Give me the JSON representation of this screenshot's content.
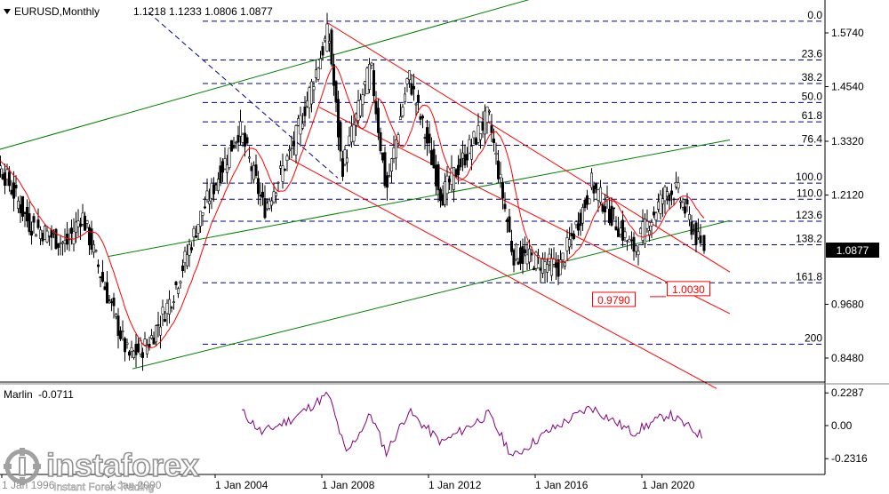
{
  "header": {
    "symbol": "EURUSD,Monthly",
    "ohlc": "1.1218 1.1233 1.0806 1.0877"
  },
  "indicator": {
    "name": "Marlin",
    "value": "-0.0711",
    "ticks": [
      "0.2287",
      "0.00",
      "-0.2316"
    ],
    "tick_values": [
      0.2287,
      0.0,
      -0.2316
    ]
  },
  "watermark": {
    "brand": "instaforex",
    "tagline": "Instant Forex Trading"
  },
  "price_ticks": [
    "1.5740",
    "1.4540",
    "1.3320",
    "1.2120",
    "0.9680",
    "0.8480"
  ],
  "price_tick_values": [
    1.574,
    1.454,
    1.332,
    1.212,
    0.968,
    0.848
  ],
  "current_price": "1.0877",
  "date_ticks": [
    "1 Jan 2004",
    "1 Jan 2008",
    "1 Jan 2012",
    "1 Jan 2016",
    "1 Jan 2020"
  ],
  "partial_date_ticks": [
    "1 Jan 1996",
    "1 Jan 2000"
  ],
  "fib_levels": [
    {
      "label": "0.0",
      "price": 1.6
    },
    {
      "label": "23.6",
      "price": 1.5135
    },
    {
      "label": "38.2",
      "price": 1.461
    },
    {
      "label": "50.0",
      "price": 1.4185
    },
    {
      "label": "61.8",
      "price": 1.3755
    },
    {
      "label": "76.4",
      "price": 1.323
    },
    {
      "label": "100.0",
      "price": 1.2385
    },
    {
      "label": "110.0",
      "price": 1.2025
    },
    {
      "label": "123.6",
      "price": 1.1535
    },
    {
      "label": "138.2",
      "price": 1.101
    },
    {
      "label": "161.8",
      "price": 1.016
    },
    {
      "label": "200",
      "price": 0.879
    }
  ],
  "price_labels": [
    {
      "text": "1.0030",
      "price": 1.003
    },
    {
      "text": "0.9790",
      "price": 0.979
    }
  ],
  "colors": {
    "candles": "#000000",
    "moving_average": "#ff0000",
    "channel_red": "#ff0000",
    "channel_green": "#008000",
    "fib_lines": "#00008b",
    "oscillator": "#800080",
    "axis_text": "#000000"
  },
  "chart_data": {
    "type": "candlestick",
    "title": "EURUSD,Monthly",
    "timeframe": "Monthly",
    "last_bar": {
      "open": 1.1218,
      "high": 1.1233,
      "low": 1.0806,
      "close": 1.0877
    },
    "ylim": [
      0.79,
      1.62
    ],
    "xlim": [
      "1994-11",
      "2022-12"
    ],
    "closes_approx": [
      {
        "date": "1995-01",
        "close": 1.31
      },
      {
        "date": "1996-01",
        "close": 1.27
      },
      {
        "date": "1997-01",
        "close": 1.15
      },
      {
        "date": "1998-06",
        "close": 1.1
      },
      {
        "date": "1999-01",
        "close": 1.17
      },
      {
        "date": "2000-01",
        "close": 0.98
      },
      {
        "date": "2000-10",
        "close": 0.85
      },
      {
        "date": "2001-07",
        "close": 0.88
      },
      {
        "date": "2002-06",
        "close": 0.99
      },
      {
        "date": "2003-06",
        "close": 1.16
      },
      {
        "date": "2004-12",
        "close": 1.36
      },
      {
        "date": "2005-11",
        "close": 1.18
      },
      {
        "date": "2006-12",
        "close": 1.32
      },
      {
        "date": "2008-04",
        "close": 1.58
      },
      {
        "date": "2008-10",
        "close": 1.27
      },
      {
        "date": "2009-11",
        "close": 1.5
      },
      {
        "date": "2010-06",
        "close": 1.22
      },
      {
        "date": "2011-04",
        "close": 1.48
      },
      {
        "date": "2012-07",
        "close": 1.21
      },
      {
        "date": "2014-04",
        "close": 1.39
      },
      {
        "date": "2015-03",
        "close": 1.08
      },
      {
        "date": "2016-12",
        "close": 1.05
      },
      {
        "date": "2017-12",
        "close": 1.2
      },
      {
        "date": "2018-02",
        "close": 1.24
      },
      {
        "date": "2019-09",
        "close": 1.09
      },
      {
        "date": "2020-12",
        "close": 1.22
      },
      {
        "date": "2021-05",
        "close": 1.22
      },
      {
        "date": "2022-04",
        "close": 1.0877
      }
    ],
    "oscillator": {
      "name": "Marlin",
      "values_approx": [
        {
          "date": "2005-01",
          "value": 0.1
        },
        {
          "date": "2005-10",
          "value": -0.05
        },
        {
          "date": "2006-12",
          "value": 0.05
        },
        {
          "date": "2008-04",
          "value": 0.22
        },
        {
          "date": "2008-12",
          "value": -0.2
        },
        {
          "date": "2009-11",
          "value": 0.08
        },
        {
          "date": "2010-06",
          "value": -0.19
        },
        {
          "date": "2011-04",
          "value": 0.1
        },
        {
          "date": "2012-07",
          "value": -0.12
        },
        {
          "date": "2014-04",
          "value": 0.08
        },
        {
          "date": "2015-03",
          "value": -0.22
        },
        {
          "date": "2016-06",
          "value": -0.05
        },
        {
          "date": "2018-02",
          "value": 0.13
        },
        {
          "date": "2019-09",
          "value": -0.05
        },
        {
          "date": "2021-01",
          "value": 0.08
        },
        {
          "date": "2022-04",
          "value": -0.0711
        }
      ]
    }
  }
}
